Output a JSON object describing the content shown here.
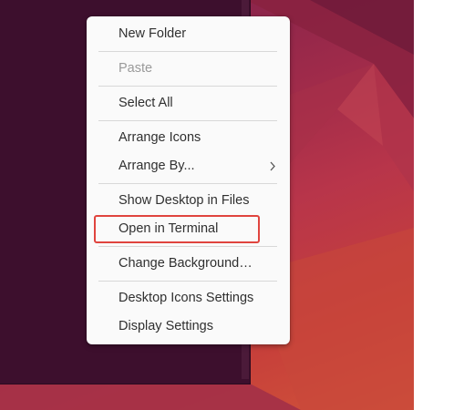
{
  "context_menu": {
    "items": [
      {
        "label": "New Folder",
        "enabled": true
      },
      {
        "label": "Paste",
        "enabled": false
      },
      {
        "label": "Select All",
        "enabled": true
      },
      {
        "label": "Arrange Icons",
        "enabled": true
      },
      {
        "label": "Arrange By...",
        "enabled": true,
        "has_submenu": true
      },
      {
        "label": "Show Desktop in Files",
        "enabled": true
      },
      {
        "label": "Open in Terminal",
        "enabled": true,
        "highlighted": true
      },
      {
        "label": "Change Background…",
        "enabled": true
      },
      {
        "label": "Desktop Icons Settings",
        "enabled": true
      },
      {
        "label": "Display Settings",
        "enabled": true
      }
    ]
  },
  "colors": {
    "highlight_border": "#e0443e",
    "menu_background": "#fafafa",
    "dark_window": "#3d0f2d"
  },
  "icons": {
    "submenu": "chevron-right-icon"
  }
}
